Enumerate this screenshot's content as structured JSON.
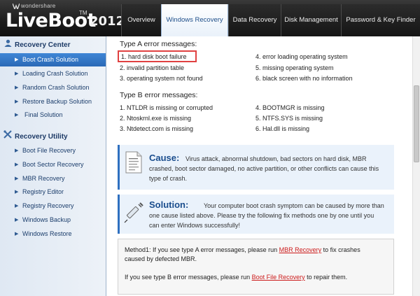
{
  "app": {
    "brand_small": "wondershare",
    "brand_name": "LiveBoot",
    "brand_tm": "TM",
    "brand_year": "2012"
  },
  "tabs": [
    {
      "label": "Overview"
    },
    {
      "label": "Windows Recovery"
    },
    {
      "label": "Data Recovery"
    },
    {
      "label": "Disk Management"
    },
    {
      "label": "Password & Key Finder"
    }
  ],
  "active_tab": "Windows Recovery",
  "sidebar": {
    "sections": [
      {
        "title": "Recovery Center",
        "icon": "user-icon",
        "items": [
          {
            "label": "Boot Crash Solution"
          },
          {
            "label": "Loading Crash Solution"
          },
          {
            "label": "Random Crash Solution"
          },
          {
            "label": "Restore Backup Solution"
          },
          {
            "label": "Final Solution"
          }
        ]
      },
      {
        "title": "Recovery Utility",
        "icon": "tools-icon",
        "items": [
          {
            "label": "Boot File Recovery"
          },
          {
            "label": "Boot Sector Recovery"
          },
          {
            "label": "MBR Recovery"
          },
          {
            "label": "Registry Editor"
          },
          {
            "label": "Registry Recovery"
          },
          {
            "label": "Windows Backup"
          },
          {
            "label": "Windows Restore"
          }
        ]
      }
    ],
    "active_item": "Boot Crash Solution"
  },
  "content": {
    "type_a": {
      "title": "Type A error messages:",
      "left": [
        "1. hard disk boot failure",
        "2. invalid partition table",
        "3. operating system not found"
      ],
      "right": [
        "4. error loading operating system",
        "5. missing operating system",
        "6. black screen with no information"
      ]
    },
    "type_b": {
      "title": "Type B error messages:",
      "left": [
        "1. NTLDR is missing or corrupted",
        "2. Ntoskrnl.exe is missing",
        "3. Ntdetect.com is missing"
      ],
      "right": [
        "4. BOOTMGR is missing",
        "5. NTFS.SYS is missing",
        "6. Hal.dll is missing"
      ]
    },
    "cause": {
      "title": "Cause:",
      "line1": "Virus attack, abnormal shutdown, bad sectors on hard disk, MBR",
      "line2": "crashed, boot sector damaged, no active partition, or other conflicts can cause this",
      "line3": "type of crash."
    },
    "solution": {
      "title": "Solution:",
      "line1": "Your computer boot crash symptom can be caused by more than",
      "line2": "one cause listed above. Please try the following fix methods one by one until you",
      "line3": "can enter Windows successfully!"
    },
    "method1": {
      "prefix": "Method1: If you see type A error messages, please run",
      "link": "MBR Recovery",
      "suffix": "to fix crashes",
      "line2": "caused by defected MBR."
    },
    "method1b": {
      "prefix": "If you see type B error messages, please run",
      "link": "Boot File Recovery",
      "suffix": "to repair them."
    }
  },
  "colors": {
    "accent": "#2a69b6",
    "highlight": "#e04141",
    "link": "#cc1a1a"
  }
}
